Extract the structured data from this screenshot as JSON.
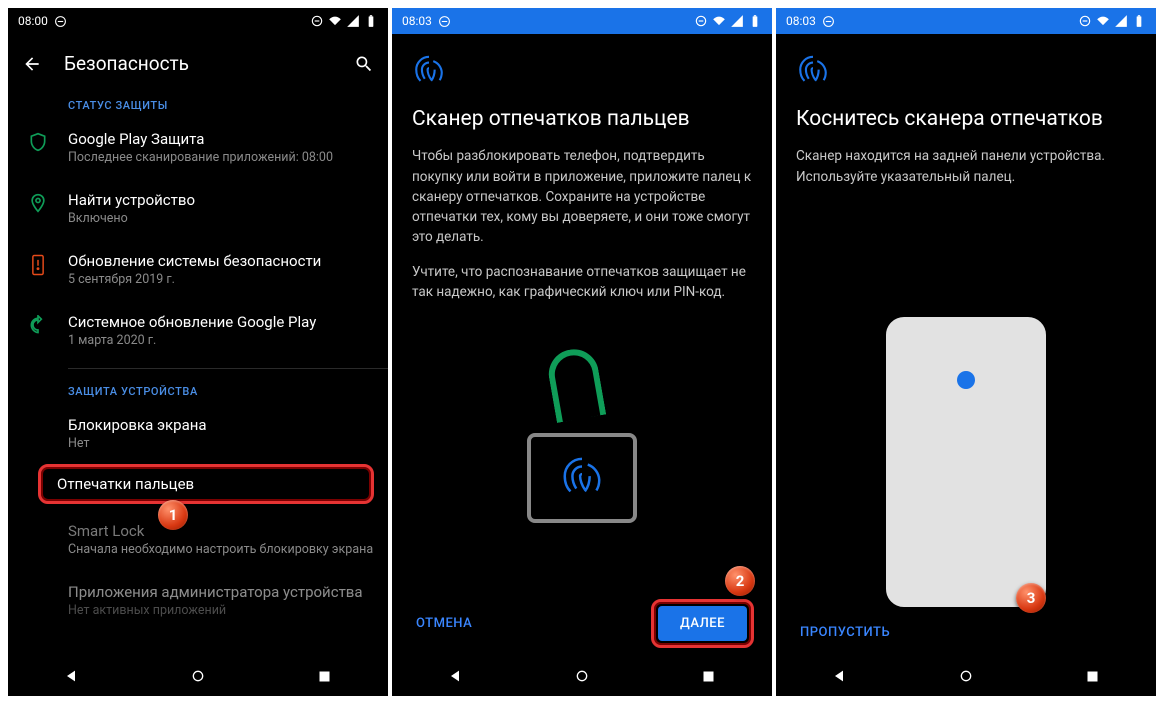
{
  "s1": {
    "time": "08:00",
    "title": "Безопасность",
    "section1": "СТАТУС ЗАЩИТЫ",
    "gp_title": "Google Play Защита",
    "gp_sub": "Последнее сканирование приложений: 08:00",
    "find_title": "Найти устройство",
    "find_sub": "Включено",
    "secupd_title": "Обновление системы безопасности",
    "secupd_sub": "5 сентября 2019 г.",
    "gpupd_title": "Системное обновление Google Play",
    "gpupd_sub": "1 марта 2020 г.",
    "section2": "ЗАЩИТА УСТРОЙСТВА",
    "lock_title": "Блокировка экрана",
    "lock_sub": "Нет",
    "fp_title": "Отпечатки пальцев",
    "smart_title": "Smart Lock",
    "smart_sub": "Сначала необходимо настроить блокировку экрана",
    "admin_title": "Приложения администратора устройства",
    "admin_sub": "Нет активных приложений",
    "badge": "1"
  },
  "s2": {
    "time": "08:03",
    "h1": "Сканер отпечатков пальцев",
    "p1": "Чтобы разблокировать телефон, подтвердить покупку или войти в приложение, приложите палец к сканеру отпечатков. Сохраните на устройстве отпечатки тех, кому вы доверяете, и они тоже смогут это делать.",
    "p2": "Учтите, что распознавание отпечатков защищает не так надежно, как графический ключ или PIN-код.",
    "cancel": "ОТМЕНА",
    "next": "ДАЛЕЕ",
    "badge": "2"
  },
  "s3": {
    "time": "08:03",
    "h1": "Коснитесь сканера отпечатков",
    "p1": "Сканер находится на задней панели устройства. Используйте указательный палец.",
    "skip": "ПРОПУСТИТЬ",
    "badge": "3"
  }
}
